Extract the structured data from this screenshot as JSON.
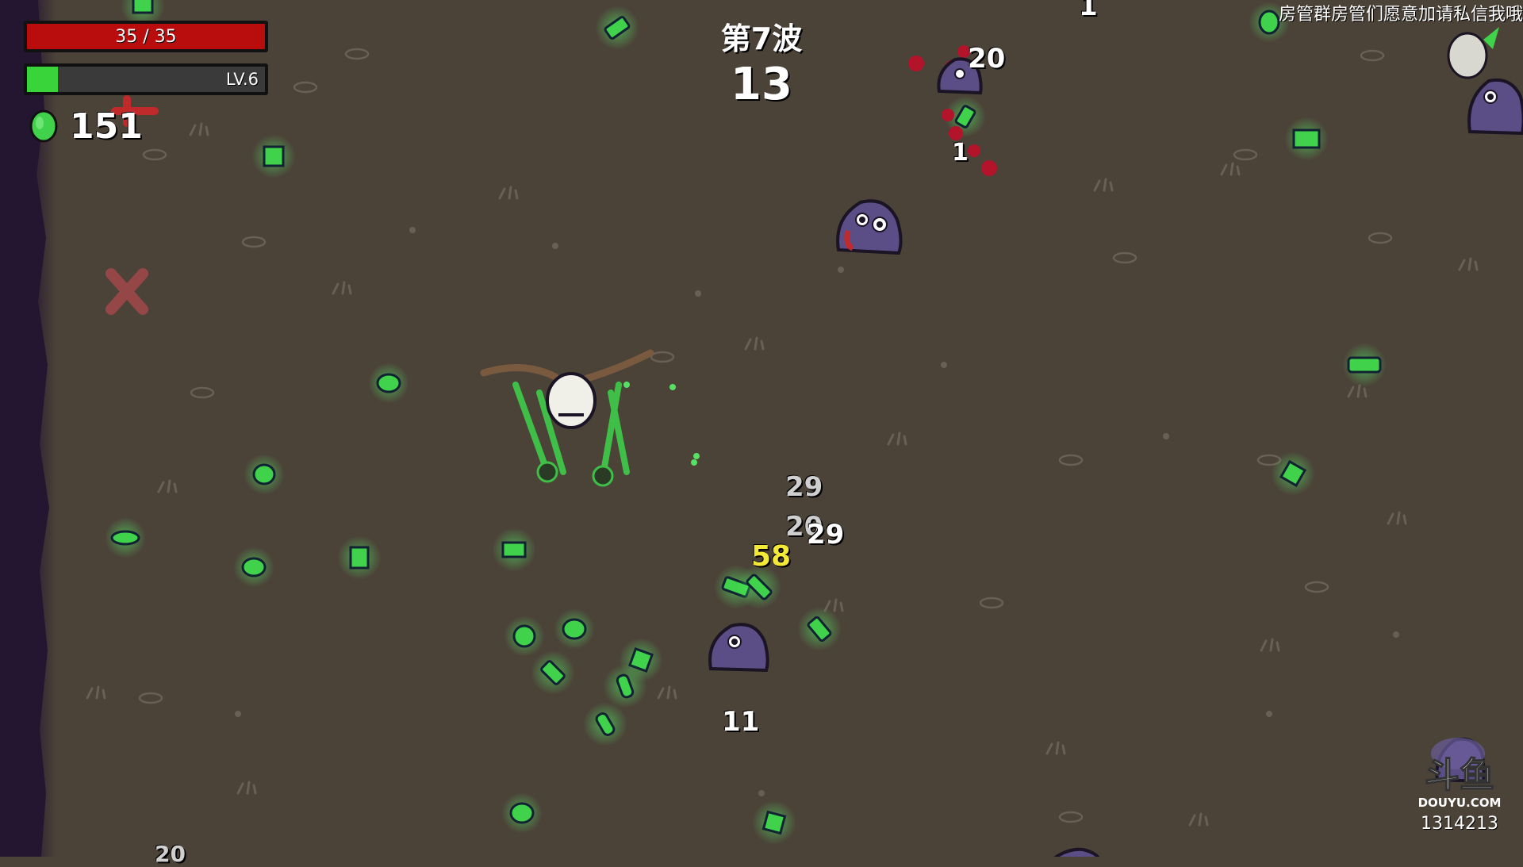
{
  "hud": {
    "hp_text": "35 / 35",
    "hp_fraction": 1.0,
    "level_text": "LV.6",
    "xp_fraction": 0.13,
    "materials_count": "151"
  },
  "wave": {
    "title": "第7波",
    "timer": "13"
  },
  "overlay": {
    "streamer_message": "房管群房管们愿意加请私信我哦",
    "watermark_id": "1314213",
    "watermark_brand": "DOUYU.COM"
  },
  "damage_numbers": [
    "20",
    "29",
    "20",
    "29",
    "58",
    "11",
    "1",
    "1",
    "20"
  ],
  "colors": {
    "ground": "#4b4238",
    "hp_red": "#b90d0d",
    "xp_green": "#39d43a",
    "material_green": "#3fd24a",
    "enemy_purple": "#5b4d86",
    "crit_yellow": "#f3e936"
  },
  "icons": [
    "material-coin-icon",
    "x-marker-icon",
    "enemy-slime-icon",
    "player-potato-icon",
    "douyu-logo-icon"
  ]
}
